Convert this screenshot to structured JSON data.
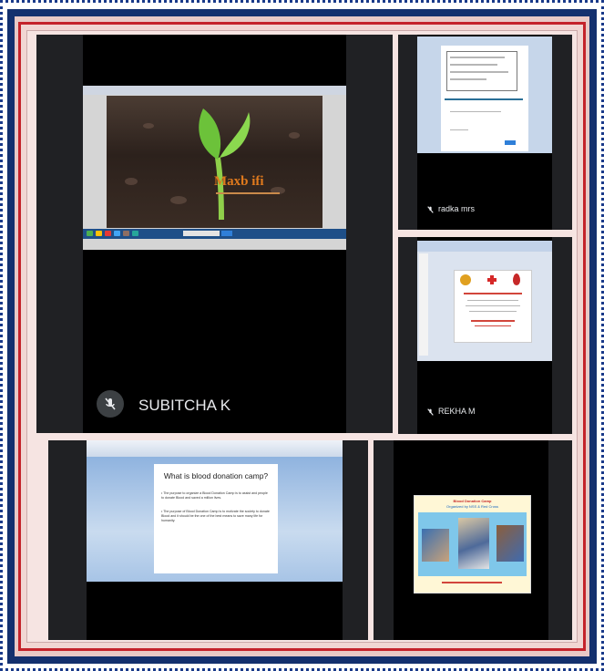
{
  "participants": {
    "main": {
      "name": "SUBITCHA K"
    },
    "top_right": {
      "name": "radka mrs"
    },
    "middle_right": {
      "name": "REKHA M"
    }
  },
  "main_slide": {
    "logo_text": "Maxb ifi"
  },
  "blood_slide": {
    "title": "What is blood donation camp?",
    "bullet1": "The purpose to organize a Blood Donation Camp is to assist and people to donate Blood and saved a million lives.",
    "bullet2": "The purpose of Blood Donation Camp is to motivate the society to donate Blood and it should be the one of the best means to save many life for humanity."
  },
  "poster_slide": {
    "title": "Blood Donation Camp",
    "subtitle": "Organized by NSS & Red Cross"
  },
  "colors": {
    "frame_blue": "#13306e",
    "frame_red": "#c4232b",
    "tile_bg": "#202124",
    "accent_blue": "#1e4f88"
  }
}
